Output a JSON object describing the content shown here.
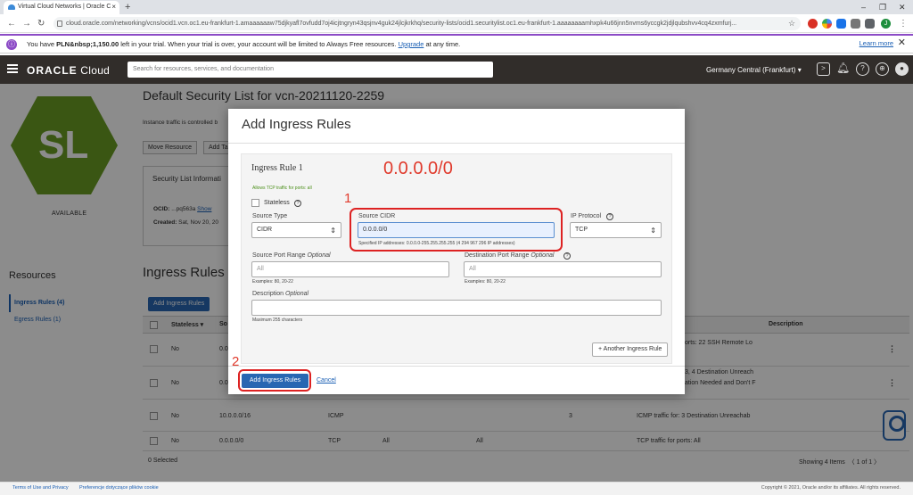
{
  "browser": {
    "tab_title": "Virtual Cloud Networks | Oracle C",
    "tab_close": "×",
    "new_tab": "+",
    "url": "cloud.oracle.com/networking/vcns/ocid1.vcn.oc1.eu-frankfurt-1.amaaaaaaw75djkyafl7ovfudd7oj4icjtngryn43qsjnv4guk24jlcjkrkhq/security-lists/ocid1.securitylist.oc1.eu-frankfurt-1.aaaaaaaamhxpk4u66jnn5nvms6yccgk2jdjlqubshvv4cq4zxmfurj...",
    "window_controls": [
      "–",
      "❐",
      "✕"
    ],
    "profile_initial": "J"
  },
  "banner": {
    "text_before": "You have ",
    "amount": "PLN&nbsp;1,150.00",
    "text_after": " left in your trial. When your trial is over, your account will be limited to Always Free resources. ",
    "upgrade_link": "Upgrade",
    "text_end": " at any time.",
    "learn_more": "Learn more",
    "close": "✕"
  },
  "header": {
    "logo_brand": "ORACLE",
    "logo_product": " Cloud",
    "search_placeholder": "Search for resources, services, and documentation",
    "region": "Germany Central (Frankfurt) ▾"
  },
  "page": {
    "title": "Default Security List for vcn-20211120-2259",
    "badge_initials": "SL",
    "badge_status": "AVAILABLE",
    "description": "Instance traffic is controlled b",
    "buttons": [
      "Move Resource",
      "Add Ta"
    ],
    "info_title": "Security List Informati",
    "ocid_label": "OCID:",
    "ocid_value": " ...pq563a ",
    "ocid_show": "Show",
    "created_label": "Created:",
    "created_value": " Sat, Nov 20, 20"
  },
  "resources": {
    "title": "Resources",
    "items": [
      "Ingress Rules (4)",
      "Egress Rules (1)"
    ]
  },
  "ingress_section": {
    "title": "Ingress Rules",
    "add_button": "Add Ingress Rules",
    "columns": {
      "stateless": "Stateless ▾",
      "so": "So",
      "description": "Description"
    },
    "rows": [
      {
        "stateless": "No",
        "source": "0.0",
        "protocol": "",
        "src_port": "",
        "dst_port": "",
        "type_code": "",
        "allows": "orts: 22 SSH Remote Lo"
      },
      {
        "stateless": "No",
        "source": "0.0",
        "protocol": "",
        "src_port": "",
        "dst_port": "",
        "type_code": "",
        "allows": "3, 4 Destination Unreach",
        "allows2": "ation Needed and Don't F"
      },
      {
        "stateless": "No",
        "source": "10.0.0.0/16",
        "protocol": "ICMP",
        "src_port": "",
        "dst_port": "",
        "type_code": "3",
        "allows": "ICMP traffic for: 3 Destination Unreachab"
      },
      {
        "stateless": "No",
        "source": "0.0.0.0/0",
        "protocol": "TCP",
        "src_port": "All",
        "dst_port": "All",
        "type_code": "",
        "allows": "TCP traffic for ports: All"
      }
    ],
    "kebab": "⋮",
    "selected": "0 Selected",
    "showing": "Showing 4 Items",
    "pager": "〈 1 of 1 〉"
  },
  "modal": {
    "title": "Add Ingress Rules",
    "rule_name": "Ingress Rule 1",
    "rule_summary": "Allows TCP traffic for ports: all",
    "stateless_label": "Stateless",
    "source_type_label": "Source Type",
    "source_type_value": "CIDR",
    "source_cidr_label": "Source CIDR",
    "source_cidr_value": "0.0.0.0/0",
    "source_cidr_hint": "Specified IP addresses: 0.0.0.0-255.255.255.255 (4 294 967 296 IP addresses)",
    "ip_protocol_label": "IP Protocol",
    "ip_protocol_value": "TCP",
    "src_port_label": "Source Port Range",
    "dst_port_label": "Destination Port Range",
    "optional": "Optional",
    "port_placeholder": "All",
    "port_examples": "Examples: 80, 20-22",
    "description_label": "Description",
    "description_hint": "Maximum 255 characters",
    "another_rule": "+ Another Ingress Rule",
    "submit": "Add Ingress Rules",
    "cancel": "Cancel",
    "qmark": "?",
    "chevron": "⌃⌄"
  },
  "annotations": {
    "cidr_callout": "0.0.0.0/0",
    "step1": "1",
    "step2": "2",
    "color": "#e03a2c"
  },
  "footer": {
    "terms": "Terms of Use and Privacy",
    "cookies": "Preferencje dotyczące plików cookie",
    "copyright": "Copyright © 2021, Oracle and/or its affiliates. All rights reserved."
  }
}
